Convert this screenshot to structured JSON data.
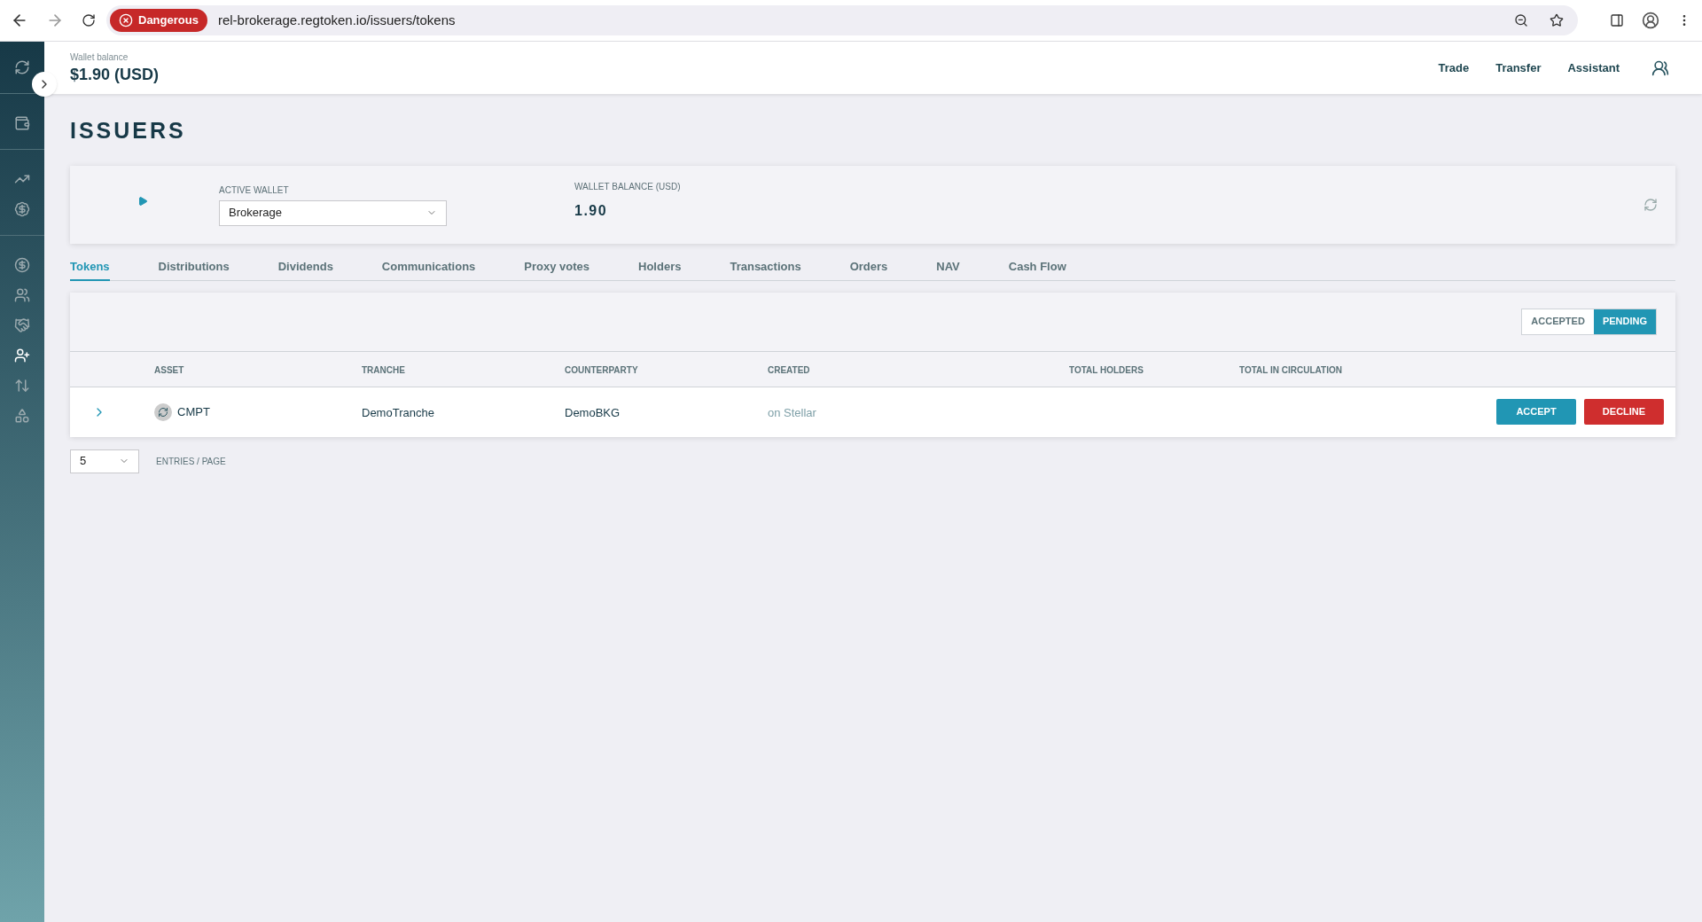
{
  "browser": {
    "badge": "Dangerous",
    "url": "rel-brokerage.regtoken.io/issuers/tokens"
  },
  "sidebar": {
    "groups": [
      [
        {
          "kind": "refresh",
          "selected": false
        }
      ],
      [
        {
          "kind": "wallet",
          "selected": false
        }
      ],
      [
        {
          "kind": "trend",
          "selected": false
        },
        {
          "kind": "invest",
          "selected": false
        }
      ],
      [
        {
          "kind": "dollar",
          "selected": false
        },
        {
          "kind": "users",
          "selected": false
        },
        {
          "kind": "handshake",
          "selected": false
        },
        {
          "kind": "user-arrow",
          "selected": true
        },
        {
          "kind": "transfer",
          "selected": false
        },
        {
          "kind": "shapes",
          "selected": false
        }
      ]
    ]
  },
  "header": {
    "balance_label": "Wallet balance",
    "balance": "$1.90 (USD)",
    "nav": [
      "Trade",
      "Transfer",
      "Assistant"
    ]
  },
  "title": "ISSUERS",
  "wallet_panel": {
    "active_wallet_label": "ACTIVE WALLET",
    "active_wallet": "Brokerage",
    "balance_label": "WALLET BALANCE (USD)",
    "balance": "1.90"
  },
  "tabs": [
    {
      "label": "Tokens",
      "selected": true
    },
    {
      "label": "Distributions",
      "selected": false
    },
    {
      "label": "Dividends",
      "selected": false
    },
    {
      "label": "Communications",
      "selected": false
    },
    {
      "label": "Proxy votes",
      "selected": false
    },
    {
      "label": "Holders",
      "selected": false
    },
    {
      "label": "Transactions",
      "selected": false
    },
    {
      "label": "Orders",
      "selected": false
    },
    {
      "label": "NAV",
      "selected": false
    },
    {
      "label": "Cash Flow",
      "selected": false
    }
  ],
  "filter": [
    {
      "label": "ACCEPTED",
      "selected": false
    },
    {
      "label": "PENDING",
      "selected": true
    }
  ],
  "table": {
    "columns": [
      "ASSET",
      "TRANCHE",
      "COUNTERPARTY",
      "CREATED",
      "TOTAL HOLDERS",
      "TOTAL IN CIRCULATION"
    ],
    "rows": [
      {
        "asset": "CMPT",
        "tranche": "DemoTranche",
        "counterparty": "DemoBKG",
        "created": "on Stellar",
        "actions": [
          {
            "kind": "accept",
            "label": "ACCEPT"
          },
          {
            "kind": "decline",
            "label": "DECLINE"
          }
        ]
      }
    ]
  },
  "pagination": {
    "page_size": "5",
    "label": "ENTRIES / PAGE"
  }
}
